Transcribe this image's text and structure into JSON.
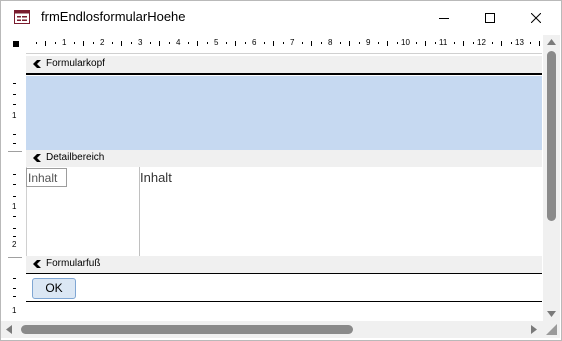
{
  "window": {
    "title": "frmEndlosformularHoehe"
  },
  "titlebar_icons": {
    "app": "form-icon",
    "minimize": "minimize-icon",
    "maximize": "maximize-icon",
    "close": "close-icon"
  },
  "ruler": {
    "h_numbers": [
      "1",
      "2",
      "3",
      "4",
      "5",
      "6",
      "7",
      "8",
      "9",
      "10",
      "11",
      "12",
      "13"
    ],
    "v_header": [
      "1"
    ],
    "v_detail": [
      "1",
      "2"
    ],
    "v_footer": [
      "1"
    ]
  },
  "sections": {
    "header": {
      "label": "Formularkopf"
    },
    "detail": {
      "label": "Detailbereich",
      "field_label": "Inhalt",
      "field_value": "Inhalt"
    },
    "footer": {
      "label": "Formularfuß",
      "ok_button": "OK"
    }
  },
  "colors": {
    "header_fill": "#c6d9f1",
    "section_bar": "#f0f0f0",
    "button_fill": "#dbe7f4"
  }
}
